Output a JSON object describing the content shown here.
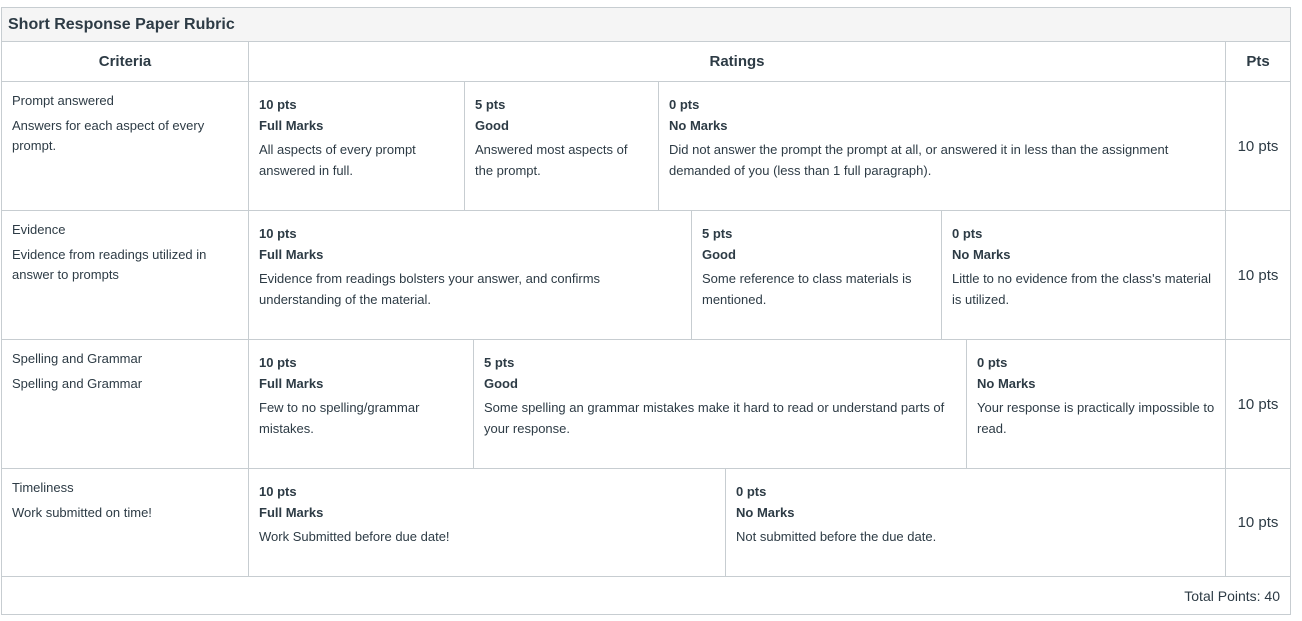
{
  "title": "Short Response Paper Rubric",
  "headers": {
    "criteria": "Criteria",
    "ratings": "Ratings",
    "pts": "Pts"
  },
  "criteria": [
    {
      "title": "Prompt answered",
      "description": "Answers for each aspect of every prompt.",
      "points": "10 pts",
      "ratings": [
        {
          "pts": "10 pts",
          "name": "Full Marks",
          "desc": "All aspects of every prompt answered in full."
        },
        {
          "pts": "5 pts",
          "name": "Good",
          "desc": "Answered most aspects of the prompt."
        },
        {
          "pts": "0 pts",
          "name": "No Marks",
          "desc": "Did not answer the prompt the prompt at all, or answered it in less than the assignment demanded of you (less than 1 full paragraph)."
        }
      ]
    },
    {
      "title": "Evidence",
      "description": "Evidence from readings utilized in answer to prompts",
      "points": "10 pts",
      "ratings": [
        {
          "pts": "10 pts",
          "name": "Full Marks",
          "desc": "Evidence from readings bolsters your answer, and confirms understanding of the material."
        },
        {
          "pts": "5 pts",
          "name": "Good",
          "desc": "Some reference to class materials is mentioned."
        },
        {
          "pts": "0 pts",
          "name": "No Marks",
          "desc": "Little to no evidence from the class's material is utilized."
        }
      ]
    },
    {
      "title": "Spelling and Grammar",
      "description": "Spelling and Grammar",
      "points": "10 pts",
      "ratings": [
        {
          "pts": "10 pts",
          "name": "Full Marks",
          "desc": "Few to no spelling/grammar mistakes."
        },
        {
          "pts": "5 pts",
          "name": "Good",
          "desc": "Some spelling an grammar mistakes make it hard to read or understand parts of your response."
        },
        {
          "pts": "0 pts",
          "name": "No Marks",
          "desc": "Your response is practically impossible to read."
        }
      ]
    },
    {
      "title": "Timeliness",
      "description": "Work submitted on time!",
      "points": "10 pts",
      "ratings": [
        {
          "pts": "10 pts",
          "name": "Full Marks",
          "desc": "Work Submitted before due date!"
        },
        {
          "pts": "0 pts",
          "name": "No Marks",
          "desc": "Not submitted before the due date."
        }
      ]
    }
  ],
  "total": "Total Points: 40"
}
